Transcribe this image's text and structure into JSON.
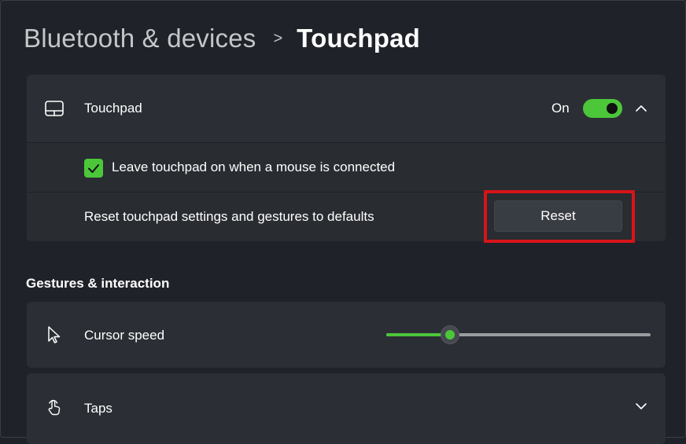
{
  "breadcrumb": {
    "parent": "Bluetooth & devices",
    "separator": ">",
    "current": "Touchpad"
  },
  "touchpad_card": {
    "icon": "touchpad-icon",
    "label": "Touchpad",
    "toggle_state_label": "On",
    "toggle_on": true,
    "expand_icon": "chevron-up-icon",
    "leave_on": {
      "checked": true,
      "label": "Leave touchpad on when a mouse is connected"
    },
    "reset": {
      "label": "Reset touchpad settings and gestures to defaults",
      "button_label": "Reset"
    }
  },
  "section": {
    "title": "Gestures & interaction"
  },
  "cursor_speed": {
    "icon": "cursor-pointer-icon",
    "label": "Cursor speed",
    "slider_fraction": 0.24
  },
  "taps": {
    "icon": "tap-gesture-icon",
    "label": "Taps",
    "expand_icon": "chevron-down-icon"
  },
  "colors": {
    "accent": "#4cc73a",
    "background": "#1f2329",
    "card": "#2b2f35",
    "highlight": "#d7141a"
  }
}
